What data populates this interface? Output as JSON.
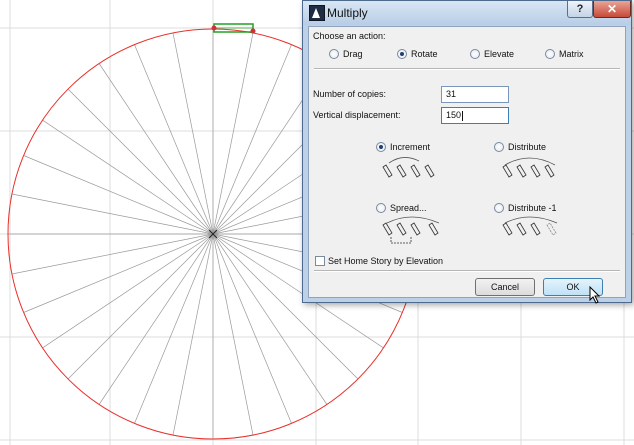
{
  "dialog": {
    "title": "Multiply",
    "help_label": "?",
    "close_label": "✕",
    "action_prompt": "Choose an action:",
    "actions": [
      {
        "label": "Drag",
        "selected": false
      },
      {
        "label": "Rotate",
        "selected": true
      },
      {
        "label": "Elevate",
        "selected": false
      },
      {
        "label": "Matrix",
        "selected": false
      }
    ],
    "copies_label": "Number of copies:",
    "copies_value": "31",
    "displacement_label": "Vertical displacement:",
    "displacement_value": "150",
    "methods": [
      {
        "label": "Increment",
        "selected": true
      },
      {
        "label": "Distribute",
        "selected": false
      },
      {
        "label": "Spread...",
        "selected": false
      },
      {
        "label": "Distribute -1",
        "selected": false
      }
    ],
    "home_story_label": "Set Home Story by Elevation",
    "home_story_checked": false,
    "cancel_label": "Cancel",
    "ok_label": "OK"
  },
  "drawing": {
    "radial_line_count": 32,
    "circle_color": "#e8302a",
    "line_color": "#9a9a9a",
    "grid_color": "#dcdcdc",
    "selected_object_color": "#22a022"
  },
  "colors": {
    "accent": "#3c7fb1",
    "titlebar": "#bcd0e8",
    "close_button": "#c74a3a"
  }
}
